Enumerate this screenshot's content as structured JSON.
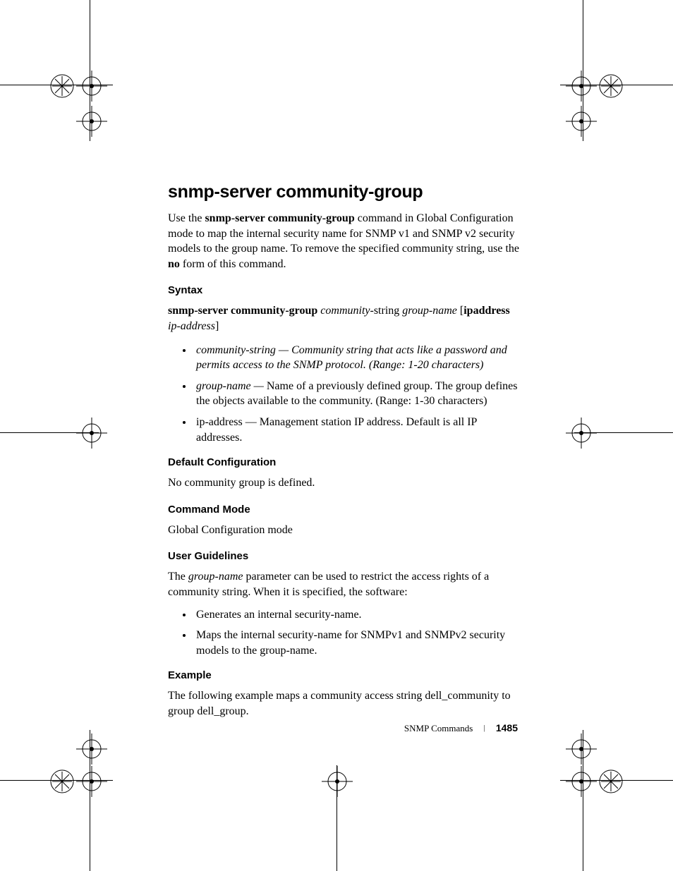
{
  "title": "snmp-server community-group",
  "intro": {
    "p1a": "Use the ",
    "p1b": "snmp-server community-group",
    "p1c": " command in Global Configuration mode to map the internal security name for SNMP v1 and SNMP v2 security models to the group name. To remove the specified community string, use the ",
    "p1d": "no",
    "p1e": " form of this command."
  },
  "syntax": {
    "heading": "Syntax",
    "line_b1": "snmp-server community-group ",
    "line_i1": "community-",
    "line_t1": "string ",
    "line_i2": "group-name ",
    "line_t2": "[",
    "line_b2": "ipaddress ",
    "line_i3": "ip-address",
    "line_t3": "]",
    "bullets": [
      {
        "i": "community-string",
        "t": " — Community string that acts like a password and permits access to the SNMP protocol. (Range: 1-20 characters)",
        "italicAll": true
      },
      {
        "i": "group-name",
        "t1": " — ",
        "t2": "Name of a previously defined group. The group defines the objects available to the community. (Range: 1-30 characters)"
      },
      {
        "t": "ip-address — Management station IP address. Default is all IP addresses."
      }
    ]
  },
  "default_config": {
    "heading": "Default Configuration",
    "body": "No community group is defined."
  },
  "command_mode": {
    "heading": "Command Mode",
    "body": "Global Configuration mode"
  },
  "user_guidelines": {
    "heading": "User Guidelines",
    "p_a": "The ",
    "p_i": "group-name",
    "p_b": " parameter can be used to restrict the access rights of a community string. When it is specified, the software:",
    "bullets": [
      "Generates an internal security-name.",
      "Maps the internal security-name for SNMPv1 and SNMPv2 security models to the group-name."
    ]
  },
  "example": {
    "heading": "Example",
    "body": "The following example maps a community access string dell_community to group dell_group."
  },
  "footer": {
    "section": "SNMP Commands",
    "page": "1485"
  }
}
